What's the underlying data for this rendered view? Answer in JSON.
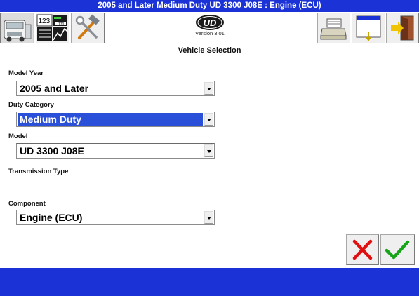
{
  "window": {
    "title": "2005 and Later Medium Duty UD 3300 J08E :  Engine (ECU)"
  },
  "toolbar": {
    "left_buttons": [
      {
        "icon": "truck-icon",
        "active": true
      },
      {
        "icon": "data-list-icon",
        "readout_top": "123",
        "readout_bottom": "170"
      },
      {
        "icon": "tools-icon"
      }
    ],
    "right_buttons": [
      {
        "icon": "printer-icon"
      },
      {
        "icon": "window-down-icon"
      },
      {
        "icon": "exit-door-icon"
      }
    ]
  },
  "logo": {
    "text": "UD",
    "version": "Version 3.01"
  },
  "main": {
    "heading": "Vehicle Selection",
    "fields": {
      "model_year": {
        "label": "Model Year",
        "value": "2005 and Later"
      },
      "duty_category": {
        "label": "Duty Category",
        "value": "Medium Duty"
      },
      "model": {
        "label": "Model",
        "value": "UD 3300 J08E"
      },
      "transmission_type": {
        "label": "Transmission Type"
      },
      "component": {
        "label": "Component",
        "value": "Engine (ECU)"
      }
    }
  },
  "actions": {
    "cancel": {
      "icon": "red-x-icon"
    },
    "ok": {
      "icon": "green-check-icon"
    }
  },
  "colors": {
    "title_bar": "#1a32d6",
    "status_bar": "#1a32d6",
    "selection": "#2a4fd8",
    "cancel": "#e01010",
    "ok": "#18a418"
  }
}
